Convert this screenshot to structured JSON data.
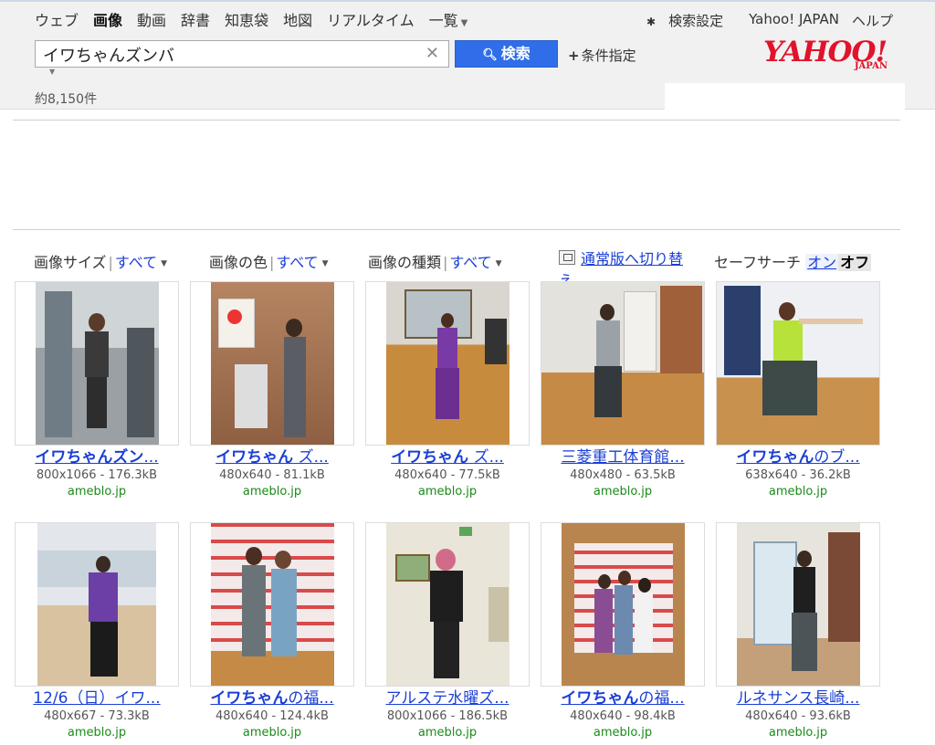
{
  "nav": {
    "items": [
      "ウェブ",
      "画像",
      "動画",
      "辞書",
      "知恵袋",
      "地図",
      "リアルタイム"
    ],
    "active": "画像",
    "more_label": "一覧"
  },
  "utility": {
    "settings_label": "検索設定",
    "home_label": "Yahoo! JAPAN",
    "help_label": "ヘルプ"
  },
  "search": {
    "query": "イワちゃんズンバ",
    "button_label": "検索",
    "advanced_label": "条件指定"
  },
  "logo": {
    "word": "YAHOO!",
    "sub": "JAPAN"
  },
  "result_count": "約8,150件",
  "filters": {
    "size_label": "画像サイズ",
    "color_label": "画像の色",
    "type_label": "画像の種類",
    "all_label": "すべて",
    "classic_label": "通常版へ切り替え",
    "safesearch_label": "セーフサーチ",
    "on_label": "オン",
    "off_label": "オフ"
  },
  "colors": {
    "link": "#1a3fd6",
    "host": "#1b8a1b",
    "search_button": "#2f6ee8",
    "logo": "#e0132b"
  },
  "results": [
    {
      "title_bold": "イワちゃんズン",
      "title_rest": "...",
      "size": "800x1066 - 176.3kB",
      "host": "ameblo.jp"
    },
    {
      "title_bold": "イワちゃん",
      "title_rest": " ズ...",
      "size": "480x640 - 81.1kB",
      "host": "ameblo.jp"
    },
    {
      "title_bold": "イワちゃん",
      "title_rest": " ズ...",
      "size": "480x640 - 77.5kB",
      "host": "ameblo.jp"
    },
    {
      "title_bold": "",
      "title_rest": "三菱重工体育館...",
      "size": "480x480 - 63.5kB",
      "host": "ameblo.jp"
    },
    {
      "title_bold": "イワちゃん",
      "title_rest": "のブ...",
      "size": "638x640 - 36.2kB",
      "host": "ameblo.jp"
    },
    {
      "title_bold": "",
      "title_rest": "12/6（日）イワ...",
      "size": "480x667 - 73.3kB",
      "host": "ameblo.jp"
    },
    {
      "title_bold": "イワちゃん",
      "title_rest": "の福...",
      "size": "480x640 - 124.4kB",
      "host": "ameblo.jp"
    },
    {
      "title_bold": "",
      "title_rest": "アルステ水曜ズ...",
      "size": "800x1066 - 186.5kB",
      "host": "ameblo.jp"
    },
    {
      "title_bold": "イワちゃん",
      "title_rest": "の福...",
      "size": "480x640 - 98.4kB",
      "host": "ameblo.jp"
    },
    {
      "title_bold": "",
      "title_rest": "ルネサンス長崎...",
      "size": "480x640 - 93.6kB",
      "host": "ameblo.jp"
    }
  ]
}
